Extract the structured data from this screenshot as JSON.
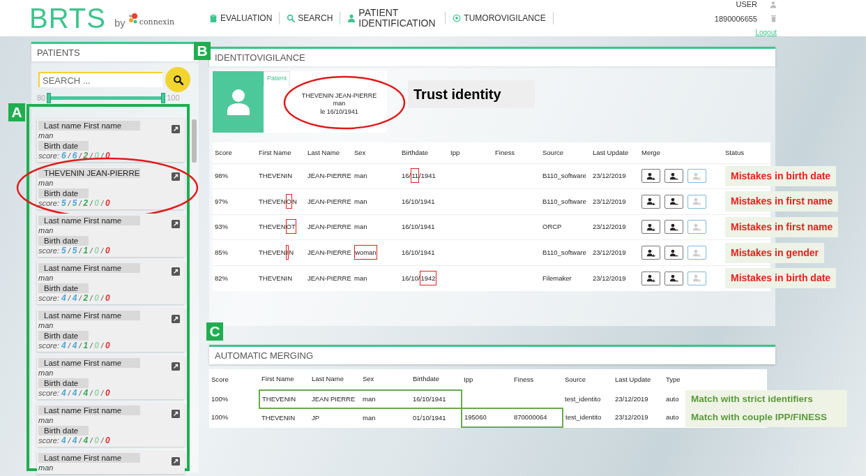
{
  "header": {
    "logo": "BRTS",
    "by": "by",
    "brand": "connexin",
    "nav": [
      {
        "label": "EVALUATION"
      },
      {
        "label": "SEARCH"
      },
      {
        "label": "PATIENT IDENTIFICATION"
      },
      {
        "label": "TUMOROVIGILANCE"
      }
    ],
    "user": "USER",
    "user_id": "1890006655",
    "logout": "Logout"
  },
  "sidebar": {
    "callout": "A",
    "title": "PATIENTS",
    "search": {
      "placeholder": "SEARCH ..."
    },
    "range": {
      "min": "80",
      "max": "100",
      "level": 1
    },
    "patients": [
      {
        "name": "Last name First name",
        "sex": "man",
        "birth": "Birth date",
        "score_label": "score:",
        "separator": "/",
        "scores": [
          {
            "value": "6",
            "color": "#4aa8d8"
          },
          {
            "value": "6",
            "color": "#4aa8d8"
          },
          {
            "value": "2",
            "color": "#3aa655"
          },
          {
            "value": "0",
            "color": "#9fd3ae"
          },
          {
            "value": "0",
            "color": "#e03030"
          }
        ],
        "circled": false
      },
      {
        "name": "THEVENIN JEAN-PIERRE",
        "sex": "man",
        "birth": "Birth date",
        "score_label": "score:",
        "separator": "/",
        "scores": [
          {
            "value": "5",
            "color": "#4aa8d8"
          },
          {
            "value": "5",
            "color": "#4aa8d8"
          },
          {
            "value": "2",
            "color": "#3aa655"
          },
          {
            "value": "0",
            "color": "#9fd3ae"
          },
          {
            "value": "0",
            "color": "#e03030"
          }
        ],
        "circled": true
      },
      {
        "name": "Last name First name",
        "sex": "man",
        "birth": "Birth date",
        "score_label": "score:",
        "separator": "/",
        "scores": [
          {
            "value": "5",
            "color": "#4aa8d8"
          },
          {
            "value": "5",
            "color": "#4aa8d8"
          },
          {
            "value": "1",
            "color": "#3aa655"
          },
          {
            "value": "0",
            "color": "#9fd3ae"
          },
          {
            "value": "0",
            "color": "#e03030"
          }
        ],
        "circled": false
      },
      {
        "name": "Last name First name",
        "sex": "man",
        "birth": "Birth date",
        "score_label": "score:",
        "separator": "/",
        "scores": [
          {
            "value": "4",
            "color": "#4aa8d8"
          },
          {
            "value": "4",
            "color": "#4aa8d8"
          },
          {
            "value": "2",
            "color": "#3aa655"
          },
          {
            "value": "0",
            "color": "#9fd3ae"
          },
          {
            "value": "0",
            "color": "#e03030"
          }
        ],
        "circled": false
      },
      {
        "name": "Last name First name",
        "sex": "man",
        "birth": "Birth date",
        "score_label": "score:",
        "separator": "/",
        "scores": [
          {
            "value": "4",
            "color": "#4aa8d8"
          },
          {
            "value": "4",
            "color": "#4aa8d8"
          },
          {
            "value": "1",
            "color": "#3aa655"
          },
          {
            "value": "0",
            "color": "#9fd3ae"
          },
          {
            "value": "0",
            "color": "#e03030"
          }
        ],
        "circled": false
      },
      {
        "name": "Last name First name",
        "sex": "man",
        "birth": "Birth date",
        "score_label": "score:",
        "separator": "/",
        "scores": [
          {
            "value": "4",
            "color": "#4aa8d8"
          },
          {
            "value": "4",
            "color": "#4aa8d8"
          },
          {
            "value": "4",
            "color": "#3aa655"
          },
          {
            "value": "0",
            "color": "#9fd3ae"
          },
          {
            "value": "0",
            "color": "#e03030"
          }
        ],
        "circled": false
      },
      {
        "name": "Last name First name",
        "sex": "man",
        "birth": "Birth date",
        "score_label": "score:",
        "separator": "/",
        "scores": [
          {
            "value": "4",
            "color": "#4aa8d8"
          },
          {
            "value": "4",
            "color": "#4aa8d8"
          },
          {
            "value": "4",
            "color": "#3aa655"
          },
          {
            "value": "0",
            "color": "#9fd3ae"
          },
          {
            "value": "0",
            "color": "#e03030"
          }
        ],
        "circled": false
      },
      {
        "name": "Last name First name",
        "sex": "man",
        "circled": false
      }
    ]
  },
  "identity": {
    "callout": "B",
    "title": "IDENTITOVIGILANCE",
    "patient": {
      "tab": "Patient",
      "name": "THEVENIN JEAN-PIERRE",
      "sex": "man",
      "birth": "le 16/10/1941",
      "circled": true
    },
    "note": "Trust identity",
    "columns": [
      "Score",
      "First Name",
      "Last Name",
      "Sex",
      "Birthdate",
      "Ipp",
      "Finess",
      "Source",
      "Last Update",
      "Merge",
      "Status"
    ],
    "rows": [
      {
        "score": "98%",
        "first_name": "THEVENIN",
        "last_name": "JEAN-PIERRE",
        "sex": "man",
        "birthdate": [
          {
            "text": "16/",
            "boxed": false
          },
          {
            "text": "11",
            "boxed": true
          },
          {
            "text": "/1941",
            "boxed": false
          }
        ],
        "source": "B110_software",
        "last_update": "23/12/2019",
        "buttons": [
          {
            "kind": "add",
            "disabled": false
          },
          {
            "kind": "remove",
            "disabled": false
          },
          {
            "kind": "unlink",
            "disabled": true
          }
        ],
        "status": "Mistakes in birth date"
      },
      {
        "score": "97%",
        "first_name": [
          {
            "text": "THEVEN",
            "boxed": false
          },
          {
            "text": "O",
            "boxed": true
          },
          {
            "text": "N",
            "boxed": false
          }
        ],
        "last_name": "JEAN-PIERRE",
        "sex": "man",
        "birthdate": "16/10/1941",
        "source": "B110_software",
        "last_update": "23/12/2019",
        "buttons": [
          {
            "kind": "add",
            "disabled": false
          },
          {
            "kind": "remove",
            "disabled": false
          },
          {
            "kind": "unlink",
            "disabled": true
          }
        ],
        "status": "Mistakes in first name"
      },
      {
        "score": "93%",
        "first_name": [
          {
            "text": "THEVEN",
            "boxed": false
          },
          {
            "text": "OT",
            "boxed": true
          }
        ],
        "last_name": "JEAN-PIERRE",
        "sex": "man",
        "birthdate": "16/10/1941",
        "source": "ORCP",
        "last_update": "23/12/2019",
        "buttons": [
          {
            "kind": "add",
            "disabled": false
          },
          {
            "kind": "remove",
            "disabled": false
          },
          {
            "kind": "unlink",
            "disabled": true
          }
        ],
        "status": "Mistakes in first name"
      },
      {
        "score": "85%",
        "first_name": [
          {
            "text": "THEVEN",
            "boxed": false
          },
          {
            "text": "I",
            "boxed": true
          },
          {
            "text": "N",
            "boxed": false
          }
        ],
        "last_name": "JEAN-PIERRE",
        "sex": [
          {
            "text": "woman",
            "boxed": true
          }
        ],
        "birthdate": "16/10/1941",
        "source": "B110_software",
        "last_update": "23/12/2019",
        "buttons": [
          {
            "kind": "add",
            "disabled": false
          },
          {
            "kind": "remove",
            "disabled": false
          },
          {
            "kind": "unlink",
            "disabled": true
          }
        ],
        "status": "Mistakes in gender"
      },
      {
        "score": "82%",
        "first_name": "THEVENIN",
        "last_name": "JEAN-PIERRE",
        "sex": "man",
        "birthdate": [
          {
            "text": "16/10/",
            "boxed": false
          },
          {
            "text": "1942",
            "boxed": true
          }
        ],
        "source": "Filemaker",
        "last_update": "23/12/2019",
        "buttons": [
          {
            "kind": "add",
            "disabled": false
          },
          {
            "kind": "remove",
            "disabled": false
          },
          {
            "kind": "unlink",
            "disabled": true
          }
        ],
        "status": "Mistakes in birth date"
      }
    ]
  },
  "merging": {
    "callout": "C",
    "title": "AUTOMATIC MERGING",
    "columns": [
      "Score",
      "First Name",
      "Last Name",
      "Sex",
      "Birthdate",
      "Ipp",
      "Finess",
      "Source",
      "Last Update",
      "Type"
    ],
    "rows": [
      {
        "cells": [
          {
            "text": "100%",
            "outlined": false
          },
          {
            "text": "THEVENIN",
            "outlined": true
          },
          {
            "text": "JEAN PIERRE",
            "outlined": true
          },
          {
            "text": "man",
            "outlined": true
          },
          {
            "text": "16/10/1941",
            "outlined": true
          },
          {
            "outlined": false
          },
          {
            "outlined": false
          },
          {
            "text": "test_identito",
            "outlined": false
          },
          {
            "text": "23/12/2019",
            "outlined": false
          },
          {
            "text": "auto",
            "outlined": false
          }
        ],
        "note": "Match with strict identifiers"
      },
      {
        "cells": [
          {
            "text": "100%",
            "outlined": false
          },
          {
            "text": "THEVENIN",
            "outlined": false
          },
          {
            "text": "JP",
            "outlined": false
          },
          {
            "text": "man",
            "outlined": false
          },
          {
            "text": "01/10/1941",
            "outlined": false
          },
          {
            "text": "195060",
            "outlined": true
          },
          {
            "text": "870000064",
            "outlined": true
          },
          {
            "text": "test_identito",
            "outlined": false
          },
          {
            "text": "23/12/2019",
            "outlined": false
          },
          {
            "text": "auto",
            "outlined": false
          }
        ],
        "note": "Match with couple IPP/FINESS"
      }
    ]
  }
}
